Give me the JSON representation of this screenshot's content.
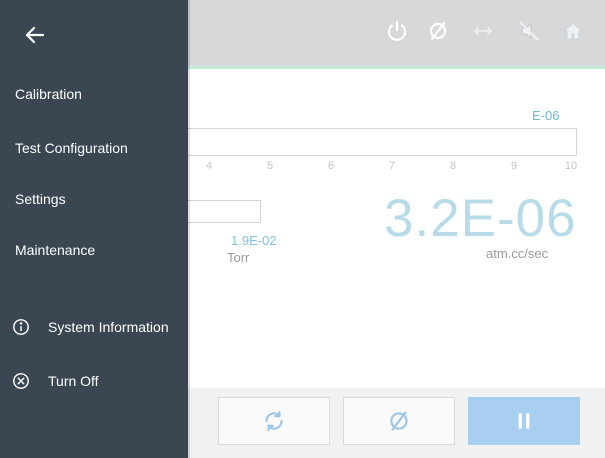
{
  "drawer": {
    "back_icon": "arrow-left-icon",
    "items": [
      {
        "label": "Calibration"
      },
      {
        "label": "Test Configuration"
      },
      {
        "label": "Settings"
      },
      {
        "label": "Maintenance"
      },
      {
        "label": "System Information",
        "icon": "info-circle-icon"
      },
      {
        "label": "Turn Off",
        "icon": "close-circle-icon"
      }
    ]
  },
  "topbar": {
    "icons": [
      "power-icon",
      "empty-set-icon",
      "arrows-horizontal-icon",
      "mute-icon",
      "home-icon"
    ]
  },
  "main": {
    "scale_label": "E-06",
    "scale_ticks": [
      "4",
      "5",
      "6",
      "7",
      "8",
      "9",
      "10"
    ],
    "pressure_value": "1.9E-02",
    "pressure_unit": "Torr",
    "leak_rate_value": "3.2E-06",
    "leak_rate_unit": "atm.cc/sec"
  },
  "controls": {
    "buttons": [
      "refresh-icon",
      "empty-set-icon",
      "pause-icon"
    ]
  },
  "colors": {
    "drawer_bg": "#3a4651",
    "accent_blue": "#6fb8d8",
    "primary_button": "#a9cff0",
    "topbar_bg": "#d6d8da"
  }
}
